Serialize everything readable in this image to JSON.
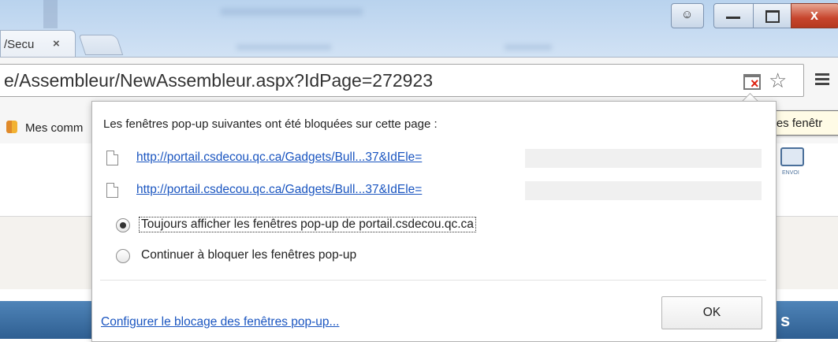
{
  "tab": {
    "title": "/Secu",
    "close": "×"
  },
  "window": {
    "close_glyph": "x",
    "user_glyph": "☺"
  },
  "omnibox": {
    "url": "e/Assembleur/NewAssembleur.aspx?IdPage=272923"
  },
  "bookmarks": {
    "item_label": "Mes comm"
  },
  "tooltip": {
    "text": "Des fenêtr"
  },
  "page": {
    "bluebar_text": "s",
    "side_icon_caption": "ENVOI"
  },
  "popup_bubble": {
    "heading": "Les fenêtres pop-up suivantes ont été bloquées sur cette page :",
    "blocked_links": [
      "http://portail.csdecou.qc.ca/Gadgets/Bull...37&IdEle=",
      "http://portail.csdecou.qc.ca/Gadgets/Bull...37&IdEle="
    ],
    "options": [
      {
        "label": "Toujours afficher les fenêtres pop-up de portail.csdecou.qc.ca",
        "selected": true
      },
      {
        "label": "Continuer à bloquer les fenêtres pop-up",
        "selected": false
      }
    ],
    "manage_link": "Configurer le blocage des fenêtres pop-up...",
    "ok_label": "OK"
  },
  "colors": {
    "link": "#1a55c0",
    "close_button": "#c7452d",
    "bluebar": "#3a6da2"
  },
  "icons": [
    "popup-blocked-icon",
    "star-icon",
    "menu-icon",
    "document-icon"
  ]
}
